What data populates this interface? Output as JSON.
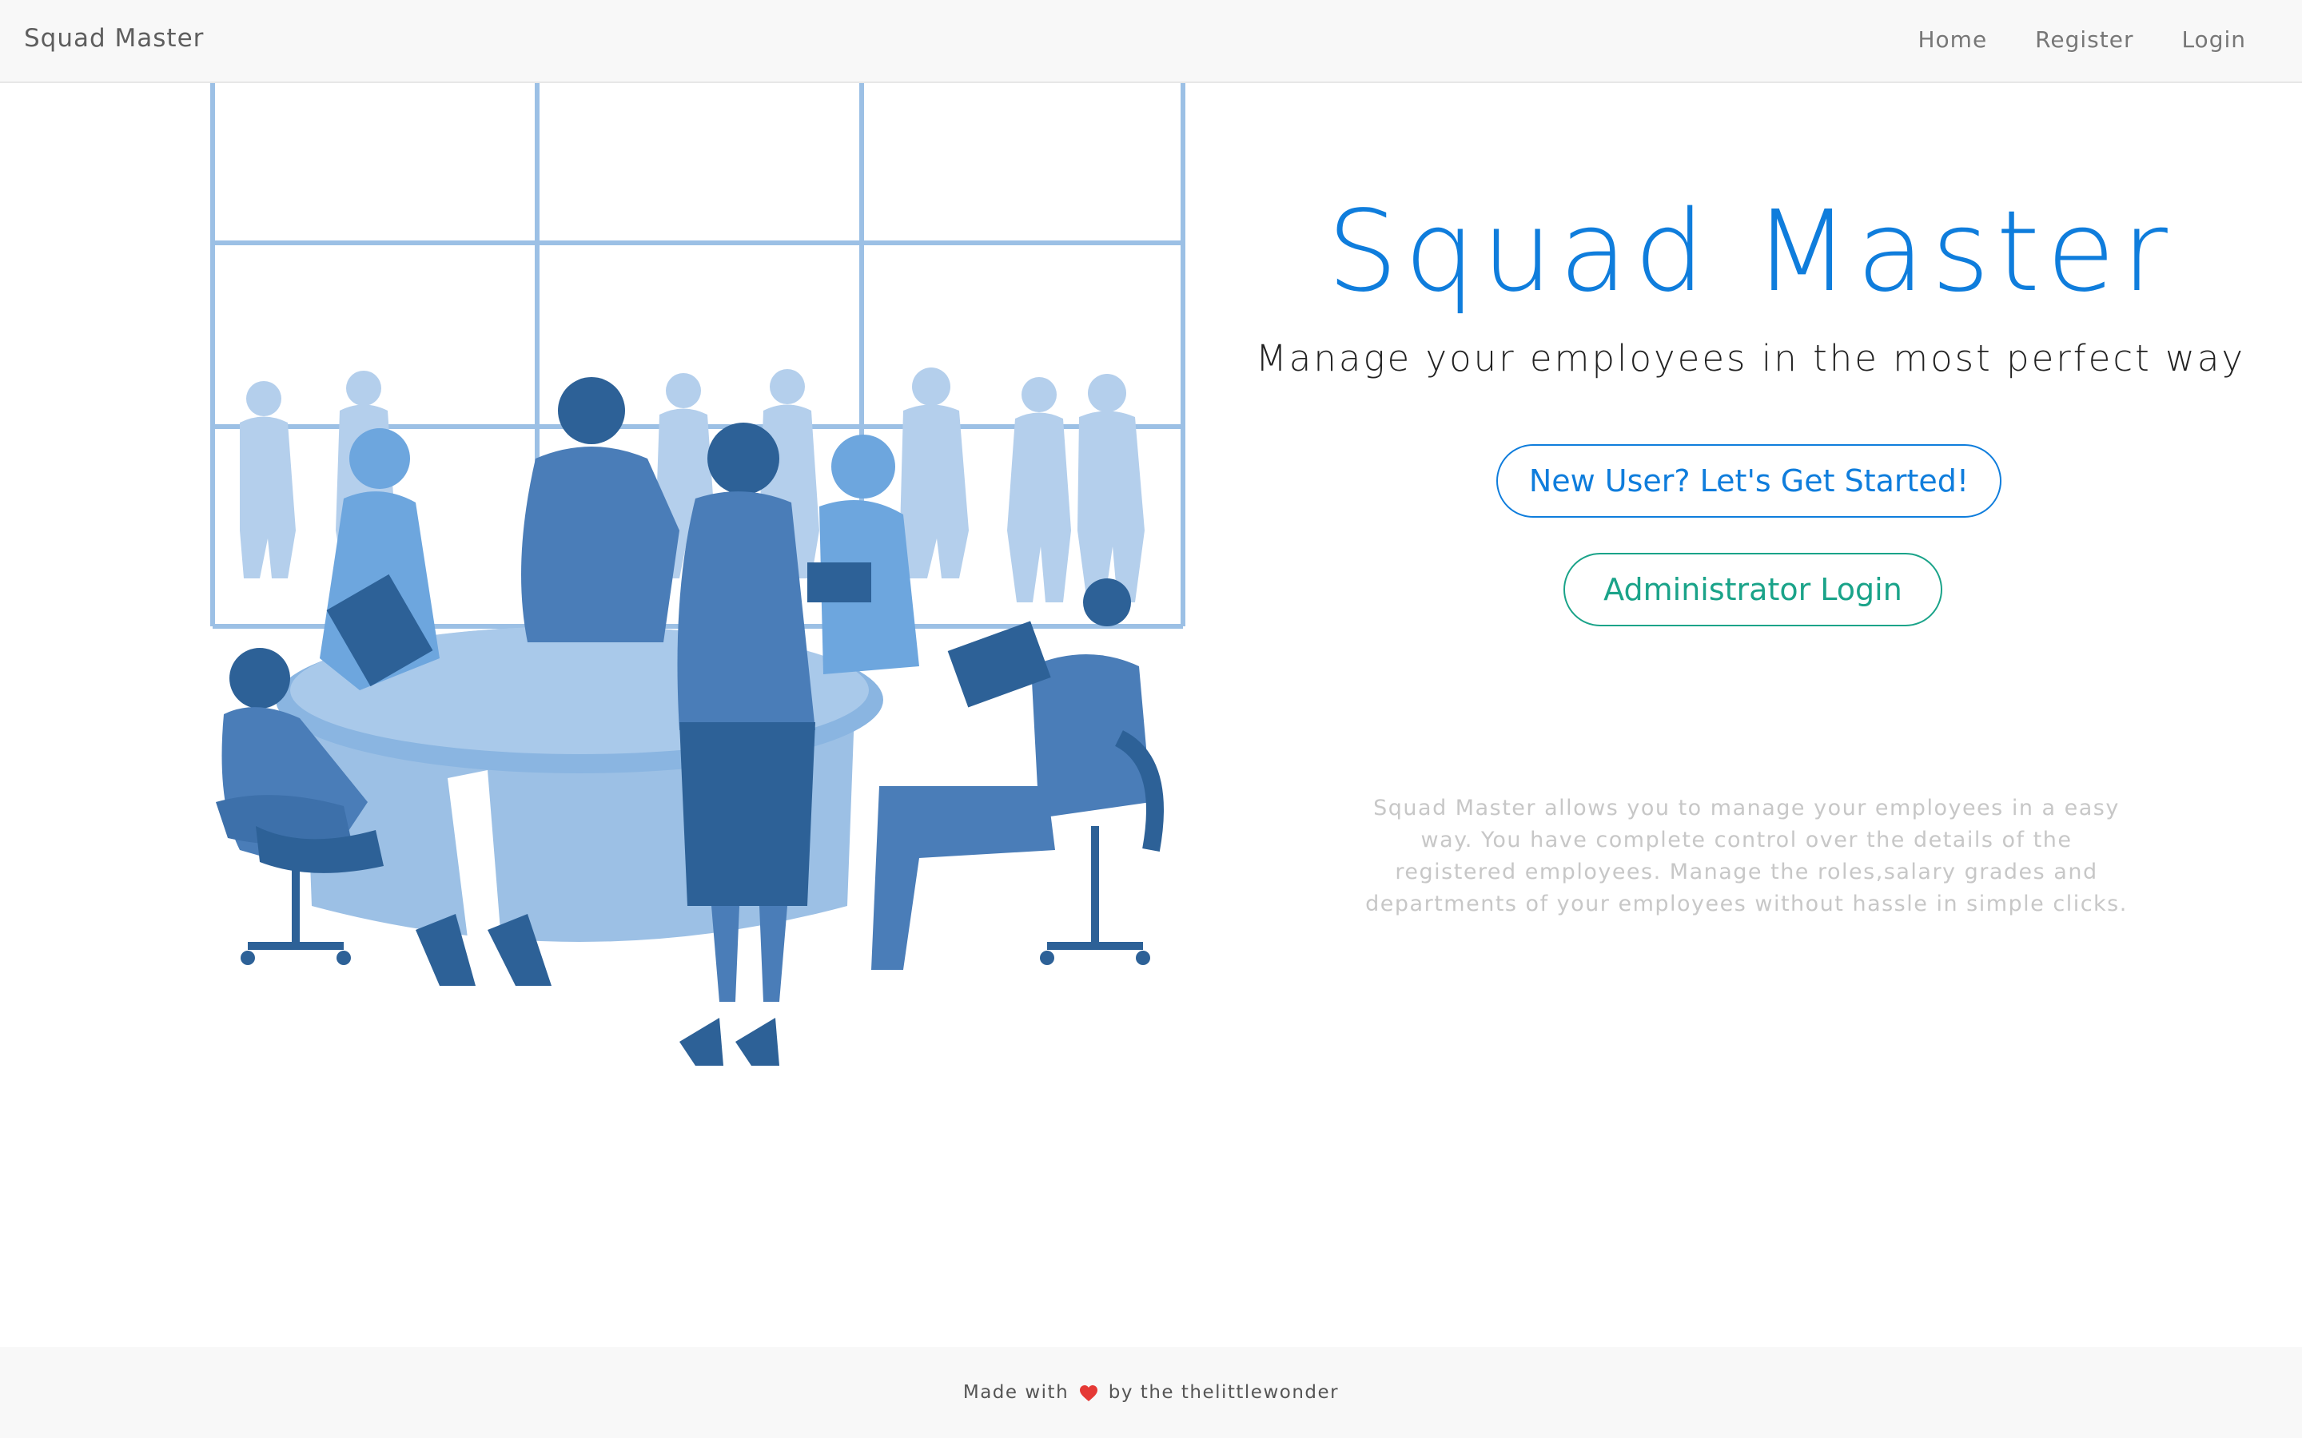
{
  "navbar": {
    "brand": "Squad Master",
    "links": [
      {
        "label": "Home"
      },
      {
        "label": "Register"
      },
      {
        "label": "Login"
      }
    ]
  },
  "hero": {
    "title": "Squad Master",
    "subtitle": "Manage your employees in the most perfect way",
    "primary_button": "New User? Let's Get Started!",
    "admin_button": "Administrator Login",
    "description": "Squad Master allows you to manage your employees in a easy way. You have complete control over the details of the registered employees. Manage the roles,salary grades and departments of your employees without hassle in simple clicks."
  },
  "footer": {
    "prefix": "Made with",
    "icon": "heart-icon",
    "suffix": "by the thelittlewonder"
  },
  "colors": {
    "primary": "#0f7ddc",
    "admin": "#1aa389",
    "illustration_dark": "#2d6197",
    "illustration_mid": "#4a7db8",
    "illustration_light": "#9cc0e5",
    "heart": "#e53935"
  }
}
